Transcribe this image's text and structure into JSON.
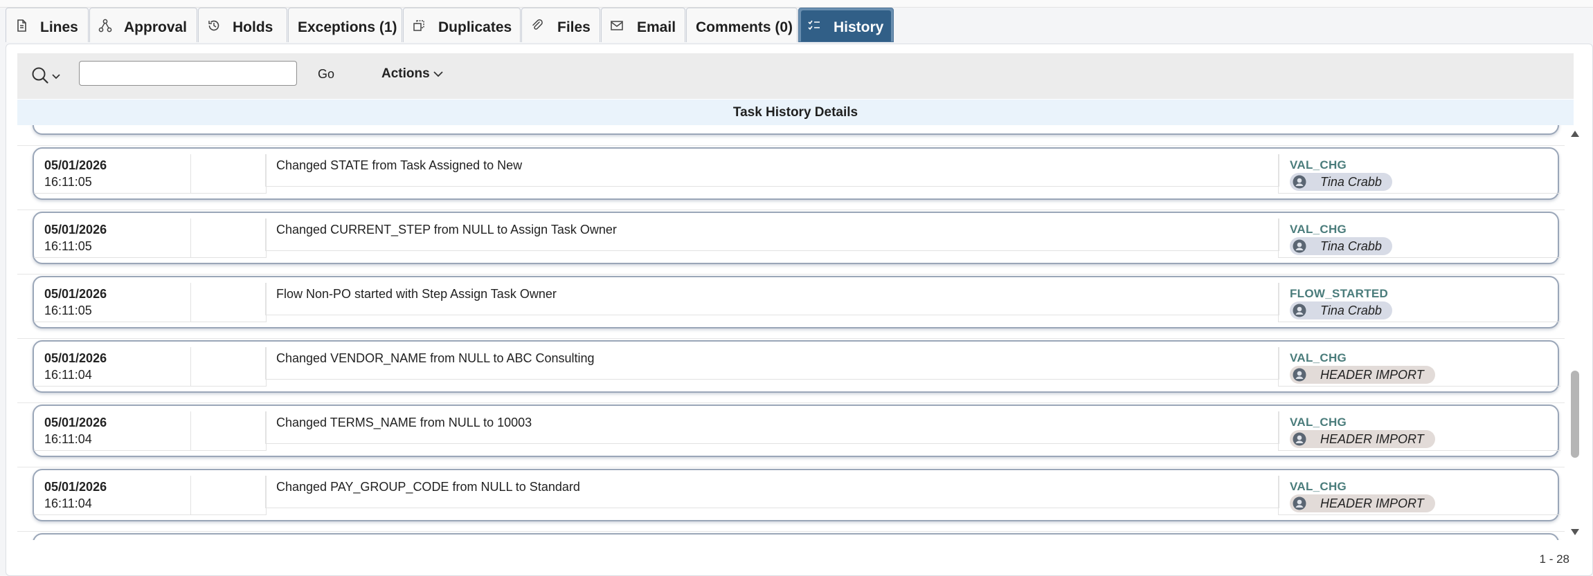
{
  "tabs": [
    {
      "label": "Lines",
      "icon": "document-icon"
    },
    {
      "label": "Approval",
      "icon": "workflow-icon"
    },
    {
      "label": "Holds",
      "icon": "clock-history-icon"
    },
    {
      "label": "Exceptions (1)",
      "icon": ""
    },
    {
      "label": "Duplicates",
      "icon": "duplicate-icon"
    },
    {
      "label": "Files",
      "icon": "paperclip-icon"
    },
    {
      "label": "Email",
      "icon": "envelope-icon"
    },
    {
      "label": "Comments (0)",
      "icon": ""
    },
    {
      "label": "History",
      "icon": "checklist-icon",
      "active": true
    }
  ],
  "toolbar": {
    "search_value": "",
    "go_label": "Go",
    "actions_label": "Actions"
  },
  "section_title": "Task History Details",
  "rows": [
    {
      "date": "05/01/2026",
      "time": "16:11:05",
      "description": "Changed STATE from Task Assigned to New",
      "event": "VAL_CHG",
      "user": "Tina Crabb",
      "user_type": "person"
    },
    {
      "date": "05/01/2026",
      "time": "16:11:05",
      "description": "Changed CURRENT_STEP from NULL to Assign Task Owner",
      "event": "VAL_CHG",
      "user": "Tina Crabb",
      "user_type": "person"
    },
    {
      "date": "05/01/2026",
      "time": "16:11:05",
      "description": "Flow Non-PO started with Step Assign Task Owner",
      "event": "FLOW_STARTED",
      "user": "Tina Crabb",
      "user_type": "person"
    },
    {
      "date": "05/01/2026",
      "time": "16:11:04",
      "description": "Changed VENDOR_NAME from NULL to ABC Consulting",
      "event": "VAL_CHG",
      "user": "HEADER IMPORT",
      "user_type": "system"
    },
    {
      "date": "05/01/2026",
      "time": "16:11:04",
      "description": "Changed TERMS_NAME from NULL to 10003",
      "event": "VAL_CHG",
      "user": "HEADER IMPORT",
      "user_type": "system"
    },
    {
      "date": "05/01/2026",
      "time": "16:11:04",
      "description": "Changed PAY_GROUP_CODE from NULL to Standard",
      "event": "VAL_CHG",
      "user": "HEADER IMPORT",
      "user_type": "system"
    }
  ],
  "pager": "1 - 28"
}
